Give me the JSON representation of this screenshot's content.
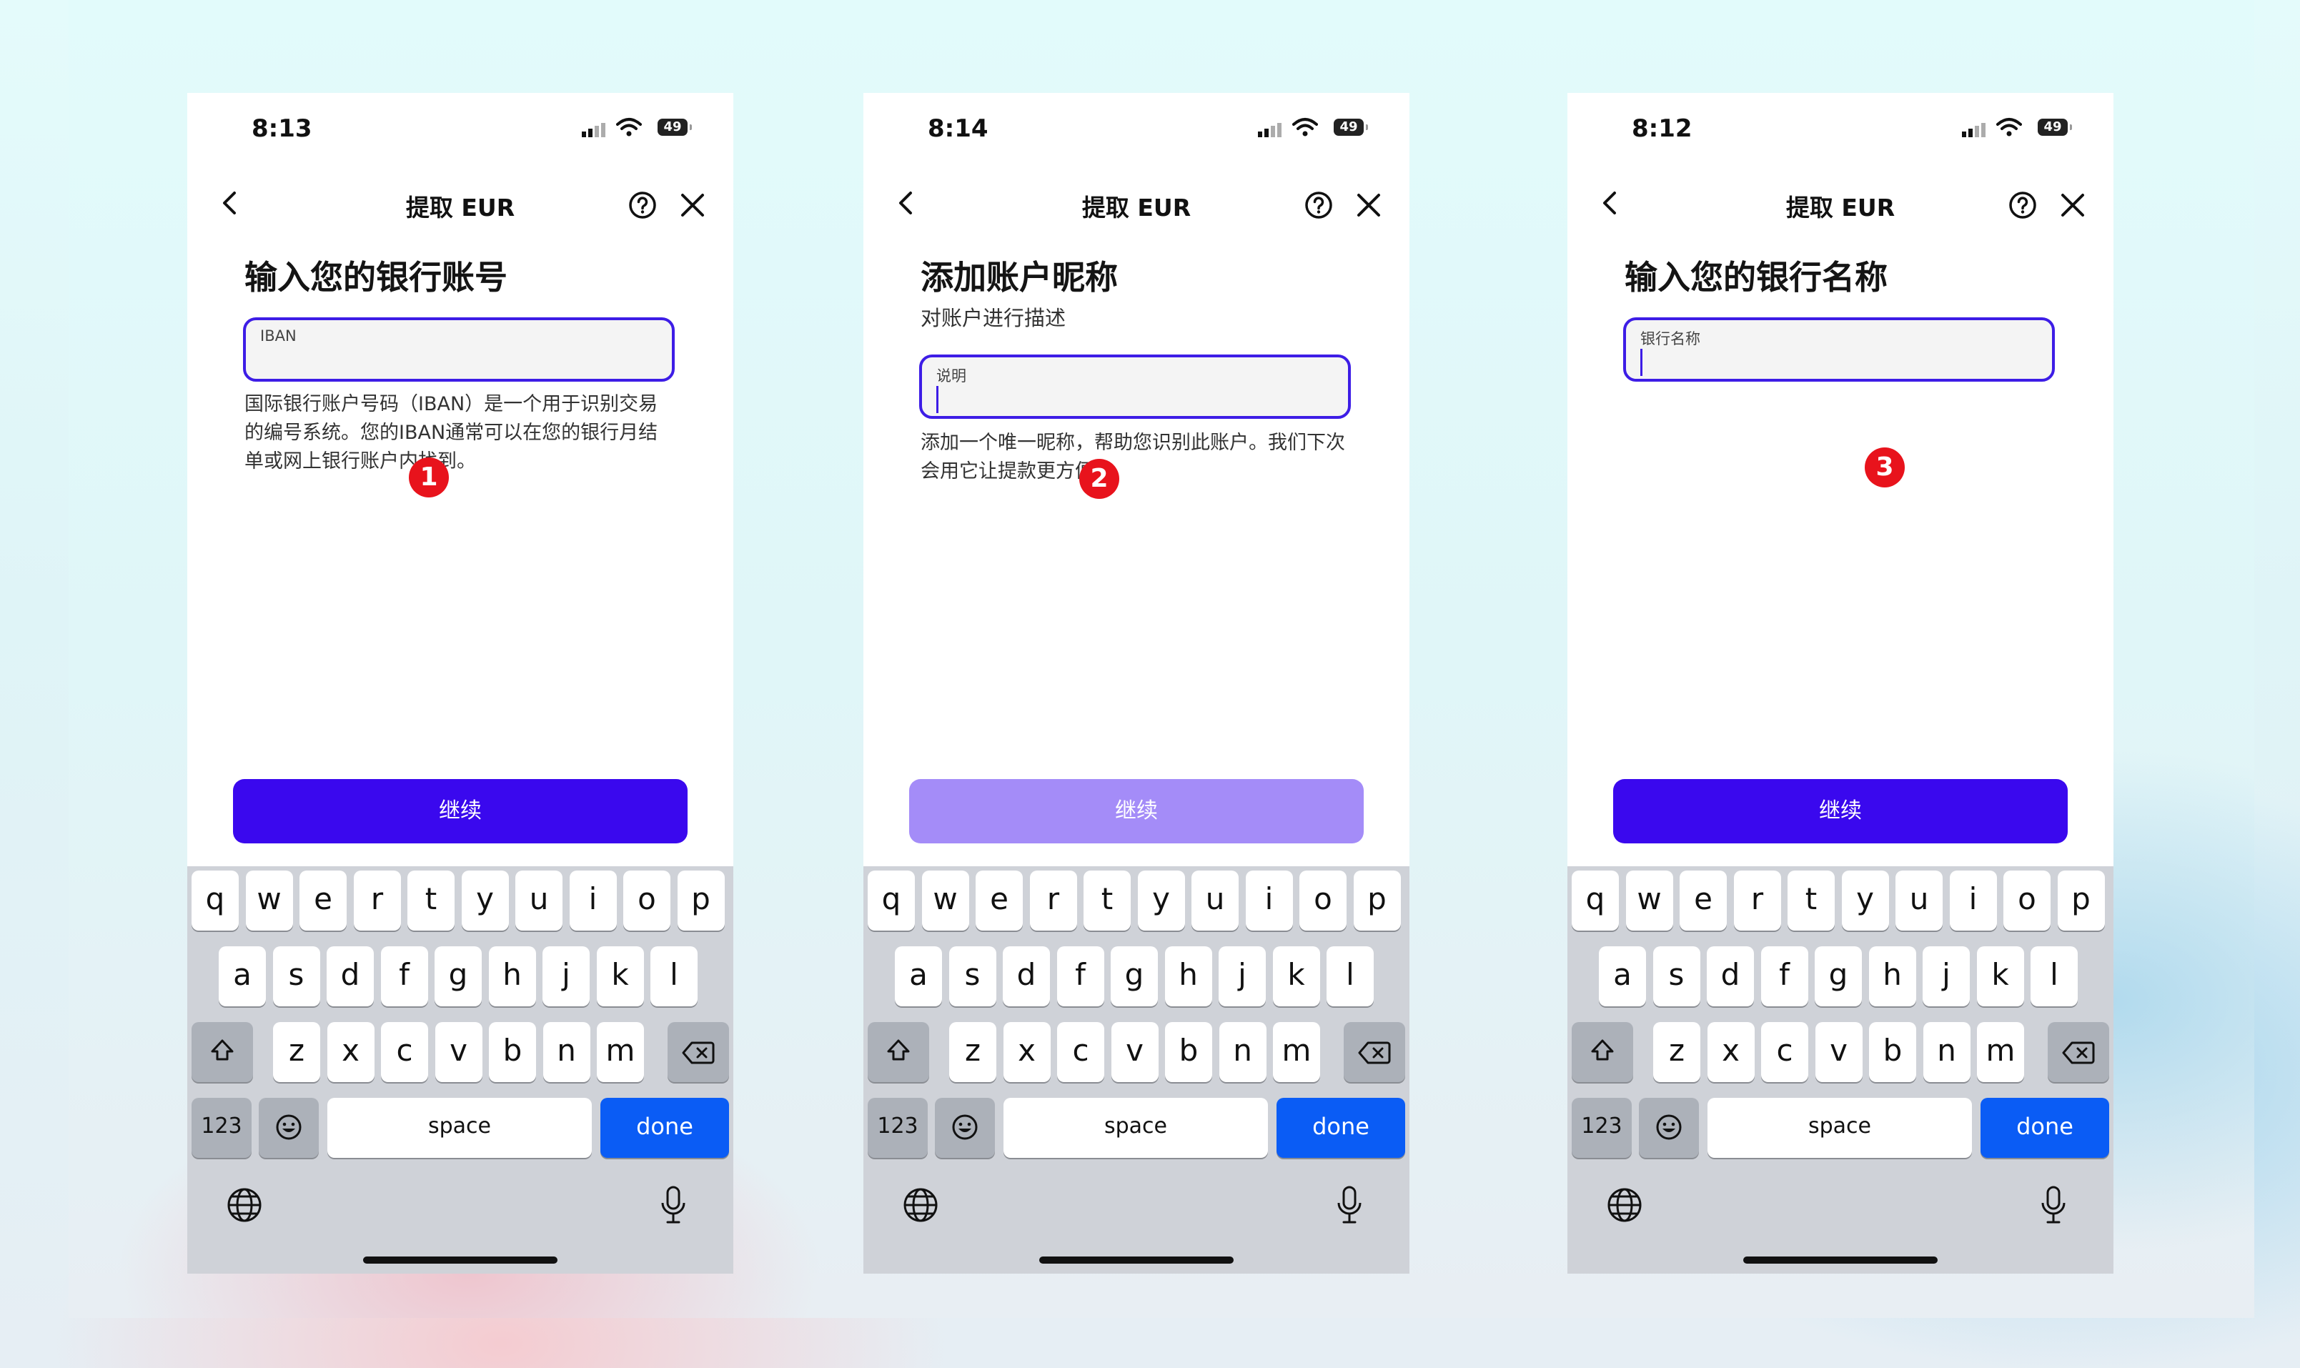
{
  "screens": [
    {
      "status": {
        "time": "8:13",
        "battery": "49"
      },
      "nav_title": "提取 EUR",
      "heading": "输入您的银行账号",
      "subheading": "",
      "field_label": "IBAN",
      "helper_lines": [
        "国际银行账户号码（IBAN）是一个用于识别交易",
        "的编号系统。您的IBAN通常可以在您的银行月结",
        "单或网上银行账户内找到。"
      ],
      "step": "1",
      "button": {
        "label": "继续",
        "state": "enabled"
      }
    },
    {
      "status": {
        "time": "8:14",
        "battery": "49"
      },
      "nav_title": "提取 EUR",
      "heading": "添加账户昵称",
      "subheading": "对账户进行描述",
      "field_label": "说明",
      "helper_lines": [
        "添加一个唯一昵称，帮助您识别此账户。我们下次",
        "会用它让提款更方便。"
      ],
      "step": "2",
      "button": {
        "label": "继续",
        "state": "disabled"
      }
    },
    {
      "status": {
        "time": "8:12",
        "battery": "49"
      },
      "nav_title": "提取 EUR",
      "heading": "输入您的银行名称",
      "subheading": "",
      "field_label": "银行名称",
      "helper_lines": [],
      "step": "3",
      "button": {
        "label": "继续",
        "state": "enabled"
      }
    }
  ],
  "keyboard": {
    "row1": [
      "q",
      "w",
      "e",
      "r",
      "t",
      "y",
      "u",
      "i",
      "o",
      "p"
    ],
    "row2": [
      "a",
      "s",
      "d",
      "f",
      "g",
      "h",
      "j",
      "k",
      "l"
    ],
    "row3": [
      "z",
      "x",
      "c",
      "v",
      "b",
      "n",
      "m"
    ],
    "numbers_label": "123",
    "space_label": "space",
    "done_label": "done"
  },
  "colors": {
    "accent": "#3a08ee",
    "accent_disabled": "#a48cf8",
    "badge": "#e8131c",
    "done_key": "#0a5cf5"
  },
  "icons": [
    "back-chevron-icon",
    "help-icon",
    "close-icon",
    "signal-icon",
    "wifi-icon",
    "battery-icon",
    "shift-icon",
    "backspace-icon",
    "emoji-icon",
    "globe-icon",
    "microphone-icon"
  ]
}
